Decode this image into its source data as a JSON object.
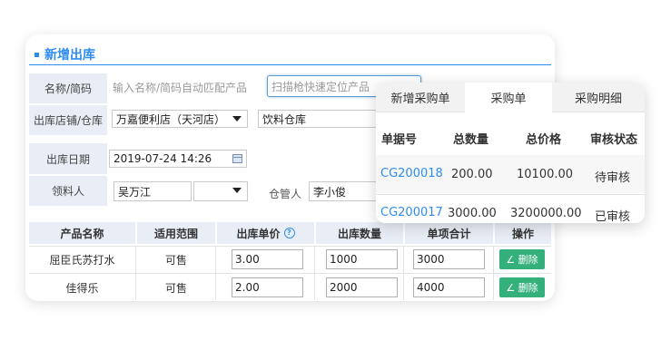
{
  "form": {
    "title": "新增出库",
    "name_label": "名称/简码",
    "name_placeholder": "输入名称/简码自动匹配产品",
    "scan_placeholder": "扫描枪快速定位产品",
    "store_label": "出库店铺/仓库",
    "store_value": "万嘉便利店（天河店）",
    "warehouse_value": "饮料仓库",
    "date_label": "出库日期",
    "date_value": "2019-07-24 14:26",
    "receiver_label": "领料人",
    "receiver_value": "吴万江",
    "keeper_label": "仓管人",
    "keeper_value": "李小俊"
  },
  "table": {
    "headers": [
      "产品名称",
      "适用范围",
      "出库单价",
      "出库数量",
      "单项合计",
      "操作"
    ],
    "help_icon": "?",
    "rows": [
      {
        "name": "屈臣氏苏打水",
        "scope": "可售",
        "price": "3.00",
        "qty": "1000",
        "total": "3000",
        "action": "∠ 删除"
      },
      {
        "name": "佳得乐",
        "scope": "可售",
        "price": "2.00",
        "qty": "2000",
        "total": "4000",
        "action": "∠ 删除"
      }
    ]
  },
  "popup": {
    "tabs": [
      "新增采购单",
      "采购单",
      "采购明细"
    ],
    "active_tab": "采购单",
    "headers": [
      "单据号",
      "总数量",
      "总价格",
      "审核状态"
    ],
    "rows": [
      {
        "id": "CG200018",
        "qty": "200.00",
        "price": "10100.00",
        "status": "待审核"
      },
      {
        "id": "CG200017",
        "qty": "3000.00",
        "price": "3200000.00",
        "status": "已审核"
      }
    ]
  },
  "colors": {
    "accent": "#2d8cf0",
    "delete_button": "#34b07a",
    "label_bg": "#e9eef6"
  }
}
